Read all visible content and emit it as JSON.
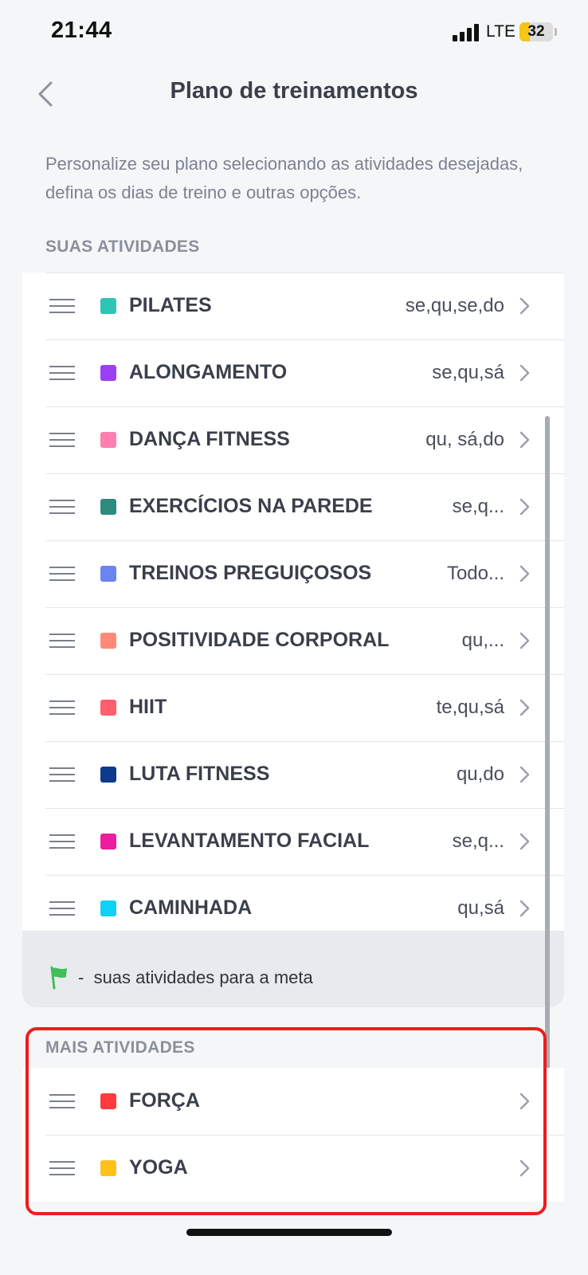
{
  "status_bar": {
    "time": "21:44",
    "network": "LTE",
    "battery": "32",
    "battery_level": 0.32
  },
  "header": {
    "title": "Plano de treinamentos",
    "back_icon": "chevron-left-icon"
  },
  "description": "Personalize seu plano selecionando as atividades desejadas, defina os dias de treino e outras opções.",
  "sections": {
    "activities_label": "SUAS ATIVIDADES",
    "more_label": "MAIS ATIVIDADES"
  },
  "activities": [
    {
      "name": "PILATES",
      "days": "se,qu,se,do",
      "color": "#2ec4b6"
    },
    {
      "name": "ALONGAMENTO",
      "days": "se,qu,sá",
      "color": "#9b3ff5"
    },
    {
      "name": "DANÇA FITNESS",
      "days": "qu, sá,do",
      "color": "#ff7fb0"
    },
    {
      "name": "EXERCÍCIOS NA PAREDE",
      "days": "se,q...",
      "color": "#2e8c7e"
    },
    {
      "name": "TREINOS PREGUIÇOSOS",
      "days": "Todo...",
      "color": "#6b84ee"
    },
    {
      "name": "POSITIVIDADE CORPORAL",
      "days": "qu,...",
      "color": "#ff8a78"
    },
    {
      "name": "HIIT",
      "days": "te,qu,sá",
      "color": "#ff5e6c"
    },
    {
      "name": "LUTA FITNESS",
      "days": "qu,do",
      "color": "#0d3a8c"
    },
    {
      "name": "LEVANTAMENTO FACIAL",
      "days": "se,q...",
      "color": "#ee1ca0"
    },
    {
      "name": "CAMINHADA",
      "days": "qu,sá",
      "color": "#0fd0f5"
    }
  ],
  "goal_note": {
    "dash": "-",
    "text": "suas atividades para a meta",
    "icon": "flag-icon",
    "icon_color": "#3fbf5a"
  },
  "more_activities": [
    {
      "name": "FORÇA",
      "days": "",
      "color": "#ff3b3b"
    },
    {
      "name": "YOGA",
      "days": "",
      "color": "#ffc21a"
    }
  ],
  "highlight_color": "#ef1c1c"
}
